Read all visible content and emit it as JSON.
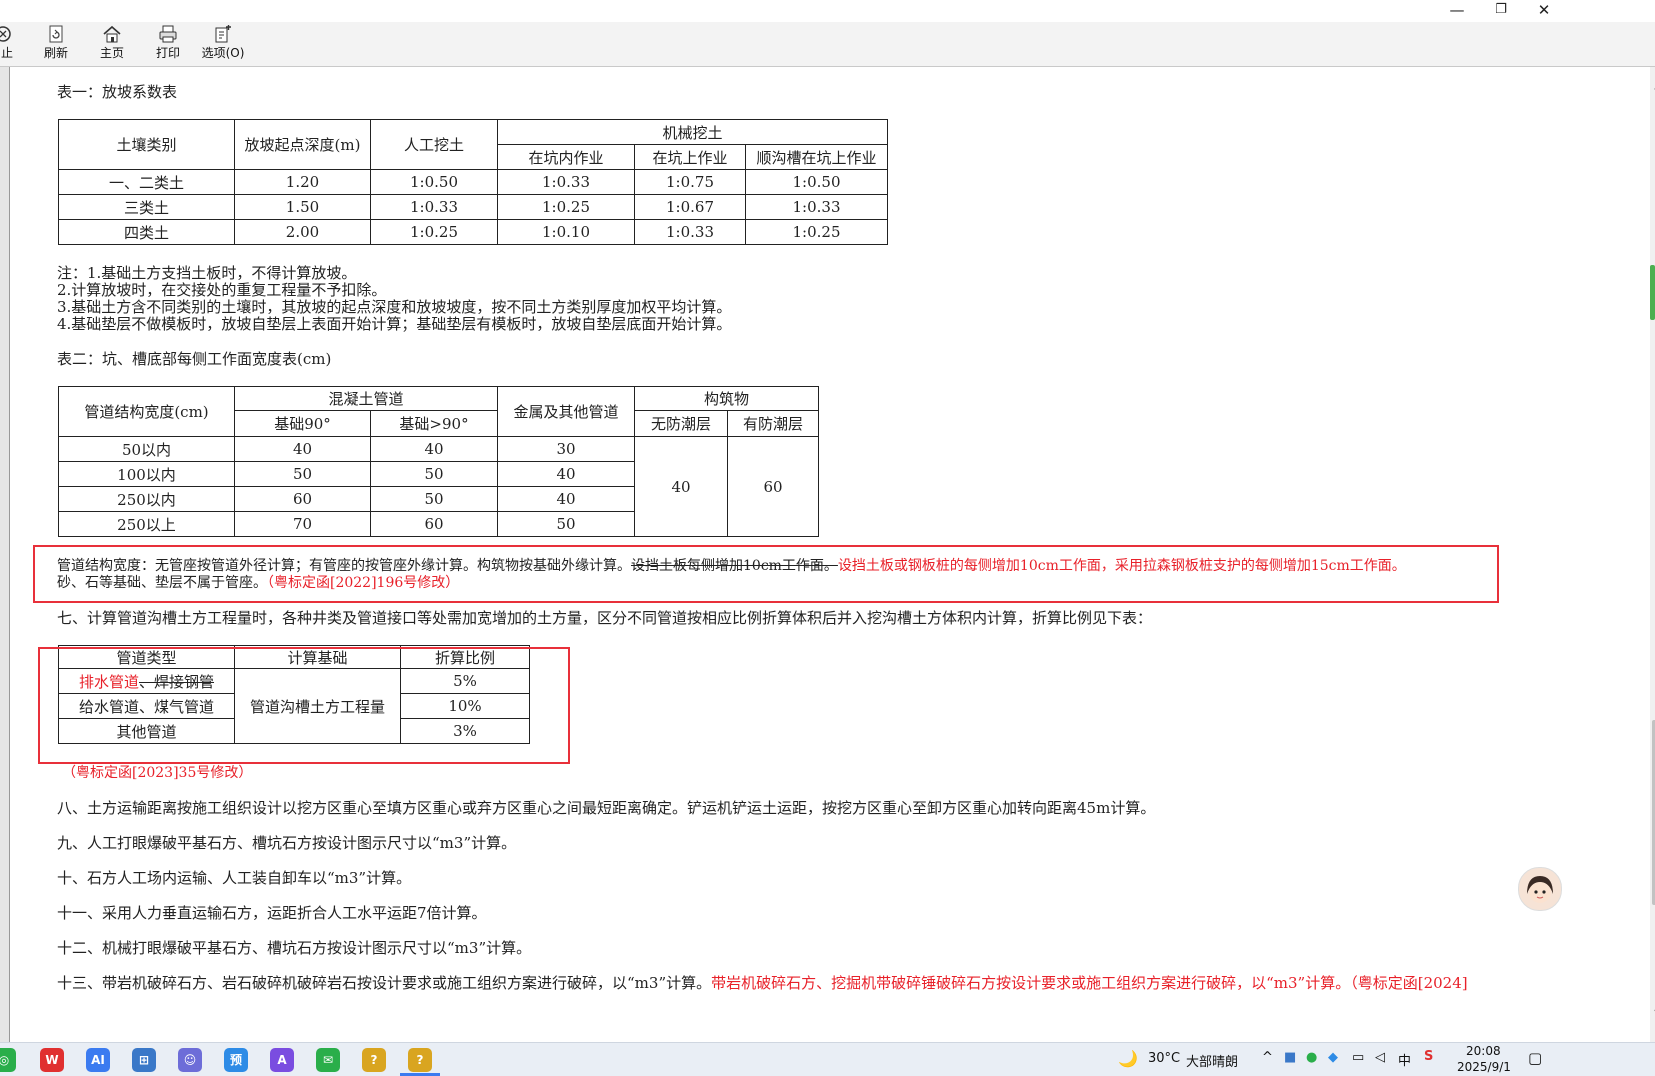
{
  "window": {
    "minimize": "—",
    "restore": "❐",
    "close": "✕"
  },
  "toolbar": {
    "stop": "止",
    "refresh": "刷新",
    "home": "主页",
    "print": "打印",
    "options": "选项(O)"
  },
  "doc": {
    "table1_title": "表一：放坡系数表",
    "table1": {
      "h_soil": "土壤类别",
      "h_depth": "放坡起点深度(m)",
      "h_manual": "人工挖土",
      "h_machine": "机械挖土",
      "h_in_pit": "在坑内作业",
      "h_on_pit": "在坑上作业",
      "h_along": "顺沟槽在坑上作业",
      "rows": [
        [
          "一、二类土",
          "1.20",
          "1:0.50",
          "1:0.33",
          "1:0.75",
          "1:0.50"
        ],
        [
          "三类土",
          "1.50",
          "1:0.33",
          "1:0.25",
          "1:0.67",
          "1:0.33"
        ],
        [
          "四类土",
          "2.00",
          "1:0.25",
          "1:0.10",
          "1:0.33",
          "1:0.25"
        ]
      ]
    },
    "notes": [
      "注：1.基础土方支挡土板时，不得计算放坡。",
      "2.计算放坡时，在交接处的重复工程量不予扣除。",
      "3.基础土方含不同类别的土壤时，其放坡的起点深度和放坡坡度，按不同土方类别厚度加权平均计算。",
      "4.基础垫层不做模板时，放坡自垫层上表面开始计算；基础垫层有模板时，放坡自垫层底面开始计算。"
    ],
    "table2_title": "表二：坑、槽底部每侧工作面宽度表(cm)",
    "table2": {
      "h_width": "管道结构宽度(cm)",
      "h_concrete": "混凝土管道",
      "h_base90": "基础90°",
      "h_base_gt90": "基础>90°",
      "h_metal": "金属及其他管道",
      "h_structure": "构筑物",
      "h_no_damp": "无防潮层",
      "h_damp": "有防潮层",
      "rows": [
        [
          "50以内",
          "40",
          "40",
          "30"
        ],
        [
          "100以内",
          "50",
          "50",
          "40"
        ],
        [
          "250以内",
          "60",
          "50",
          "40"
        ],
        [
          "250以上",
          "70",
          "60",
          "50"
        ]
      ],
      "no_damp_value": "40",
      "damp_value": "60"
    },
    "para_pipe_1": "管道结构宽度：无管座按管道外径计算；有管座的按管座外缘计算。构筑物按基础外缘计算。",
    "para_pipe_struck": "设挡土板每侧增加10cm工作面。",
    "para_pipe_red": "设挡土板或钢板桩的每侧增加10cm工作面，采用拉森钢板桩支护的每侧增加15cm工作面。",
    "para_pipe_2": "砂、石等基础、垫层不属于管座。",
    "para_pipe_note": "（粤标定函[2022]196号修改）",
    "item7": "七、计算管道沟槽土方工程量时，各种井类及管道接口等处需加宽增加的土方量，区分不同管道按相应比例折算体积后并入挖沟槽土方体积内计算，折算比例见下表：",
    "table3": {
      "h_type": "管道类型",
      "h_base": "计算基础",
      "h_ratio": "折算比例",
      "row1_red": "排水管道",
      "row1_struck": "、焊接钢管",
      "row2": "给水管道、煤气管道",
      "row3": "其他管道",
      "base_value": "管道沟槽土方工程量",
      "ratios": [
        "5%",
        "10%",
        "3%"
      ]
    },
    "table3_note": "（粤标定函[2023]35号修改）",
    "item8": "八、土方运输距离按施工组织设计以挖方区重心至填方区重心或弃方区重心之间最短距离确定。铲运机铲运土运距，按挖方区重心至卸方区重心加转向距离45m计算。",
    "item9": "九、人工打眼爆破平基石方、槽坑石方按设计图示尺寸以“m3”计算。",
    "item10": "十、石方人工场内运输、人工装自卸车以“m3”计算。",
    "item11": "十一、采用人力垂直运输石方，运距折合人工水平运距7倍计算。",
    "item12": "十二、机械打眼爆破平基石方、槽坑石方按设计图示尺寸以“m3”计算。",
    "item13_black": "十三、带岩机破碎石方、岩石破碎机破碎岩石按设计要求或施工组织方案进行破碎，以“m3”计算。",
    "item13_red": "带岩机破碎石方、挖掘机带破碎锤破碎石方按设计要求或施工组织方案进行破碎，以“m3”计算。（粤标定函[2024]"
  },
  "taskbar": {
    "apps": [
      {
        "name": "wps-icon",
        "label": "W",
        "color": "#e03030"
      },
      {
        "name": "ai-icon",
        "label": "AI",
        "color": "#3b7bf0"
      },
      {
        "name": "calc-icon",
        "label": "⊞",
        "color": "#3a78c8"
      },
      {
        "name": "avatar-app-icon",
        "label": "☺",
        "color": "#6d6dd8"
      },
      {
        "name": "preview-icon",
        "label": "预",
        "color": "#2d8be6"
      },
      {
        "name": "editor-icon",
        "label": "A",
        "color": "#7a4de0"
      },
      {
        "name": "wechat-icon",
        "label": "✉",
        "color": "#2aae4a"
      },
      {
        "name": "help-file-icon",
        "label": "?",
        "color": "#d9a520"
      },
      {
        "name": "help-file-active-icon",
        "label": "?",
        "color": "#d9a520"
      }
    ],
    "weather_temp": "30°C",
    "weather_text": "大部晴朗",
    "ime": "中",
    "time": "20:08",
    "date": "2025/9/1"
  }
}
